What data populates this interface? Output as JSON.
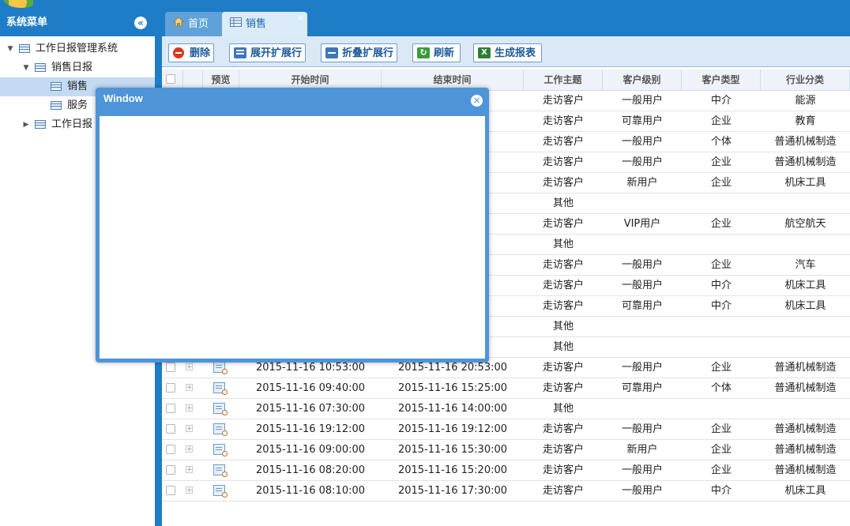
{
  "colors": {
    "primary": "#1f7dc7",
    "toolbar_bg": "#dbe8f5",
    "selected": "#c3daf2",
    "window": "#4e94d9"
  },
  "sidebar": {
    "title": "系统菜单",
    "collapse_icon": "double-chevron-left-icon",
    "tree": [
      {
        "label": "工作日报管理系统",
        "depth": 0,
        "expanded": true,
        "selected": false
      },
      {
        "label": "销售日报",
        "depth": 1,
        "expanded": true,
        "selected": false
      },
      {
        "label": "销售",
        "depth": 2,
        "leaf": true,
        "selected": true
      },
      {
        "label": "服务",
        "depth": 2,
        "leaf": true,
        "selected": false
      },
      {
        "label": "工作日报",
        "depth": 1,
        "expanded": false,
        "selected": false
      }
    ]
  },
  "tabs": [
    {
      "label": "首页",
      "icon": "home-icon"
    },
    {
      "label": "销售",
      "icon": "table-icon",
      "closable": true
    }
  ],
  "tab_close": "×",
  "toolbar": [
    {
      "label": "删除",
      "icon": "delete-icon"
    },
    {
      "label": "展开扩展行",
      "icon": "expand-rows-icon"
    },
    {
      "label": "折叠扩展行",
      "icon": "collapse-rows-icon"
    },
    {
      "label": "刷新",
      "icon": "refresh-icon"
    },
    {
      "label": "生成报表",
      "icon": "excel-report-icon"
    }
  ],
  "grid": {
    "columns": [
      "预览",
      "开始时间",
      "结束时间",
      "工作主题",
      "客户级别",
      "客户类型",
      "行业分类"
    ],
    "rows": [
      {
        "start": "",
        "end": ":00",
        "topic": "走访客户",
        "level": "一般用户",
        "type": "中介",
        "industry": "能源"
      },
      {
        "start": "",
        "end": ":00",
        "topic": "走访客户",
        "level": "可靠用户",
        "type": "企业",
        "industry": "教育"
      },
      {
        "start": "",
        "end": ":00",
        "topic": "走访客户",
        "level": "一般用户",
        "type": "个体",
        "industry": "普通机械制造"
      },
      {
        "start": "",
        "end": ":00",
        "topic": "走访客户",
        "level": "一般用户",
        "type": "企业",
        "industry": "普通机械制造"
      },
      {
        "start": "",
        "end": ":00",
        "topic": "走访客户",
        "level": "新用户",
        "type": "企业",
        "industry": "机床工具"
      },
      {
        "start": "",
        "end": ":00",
        "topic": "其他",
        "level": "",
        "type": "",
        "industry": ""
      },
      {
        "start": "",
        "end": ":00",
        "topic": "走访客户",
        "level": "VIP用户",
        "type": "企业",
        "industry": "航空航天"
      },
      {
        "start": "",
        "end": ":00",
        "topic": "其他",
        "level": "",
        "type": "",
        "industry": ""
      },
      {
        "start": "",
        "end": ":00",
        "topic": "走访客户",
        "level": "一般用户",
        "type": "企业",
        "industry": "汽车"
      },
      {
        "start": "",
        "end": ":00",
        "topic": "走访客户",
        "level": "一般用户",
        "type": "中介",
        "industry": "机床工具"
      },
      {
        "start": "",
        "end": ":00",
        "topic": "走访客户",
        "level": "可靠用户",
        "type": "中介",
        "industry": "机床工具"
      },
      {
        "start": "",
        "end": ":00",
        "topic": "其他",
        "level": "",
        "type": "",
        "industry": ""
      },
      {
        "start": "",
        "end": ":00",
        "topic": "其他",
        "level": "",
        "type": "",
        "industry": ""
      },
      {
        "start": "2015-11-16 10:53:00",
        "end": "2015-11-16 20:53:00",
        "topic": "走访客户",
        "level": "一般用户",
        "type": "企业",
        "industry": "普通机械制造"
      },
      {
        "start": "2015-11-16 09:40:00",
        "end": "2015-11-16 15:25:00",
        "topic": "走访客户",
        "level": "可靠用户",
        "type": "个体",
        "industry": "普通机械制造"
      },
      {
        "start": "2015-11-16 07:30:00",
        "end": "2015-11-16 14:00:00",
        "topic": "其他",
        "level": "",
        "type": "",
        "industry": ""
      },
      {
        "start": "2015-11-16 19:12:00",
        "end": "2015-11-16 19:12:00",
        "topic": "走访客户",
        "level": "一般用户",
        "type": "企业",
        "industry": "普通机械制造"
      },
      {
        "start": "2015-11-16 09:00:00",
        "end": "2015-11-16 15:30:00",
        "topic": "走访客户",
        "level": "新用户",
        "type": "企业",
        "industry": "普通机械制造"
      },
      {
        "start": "2015-11-16 08:20:00",
        "end": "2015-11-16 15:20:00",
        "topic": "走访客户",
        "level": "一般用户",
        "type": "企业",
        "industry": "普通机械制造"
      },
      {
        "start": "2015-11-16 08:10:00",
        "end": "2015-11-16 17:30:00",
        "topic": "走访客户",
        "level": "一般用户",
        "type": "中介",
        "industry": "机床工具"
      }
    ],
    "expander_glyph": "+"
  },
  "window": {
    "title": "Window",
    "close_glyph": "×",
    "close_icon": "close-icon"
  }
}
